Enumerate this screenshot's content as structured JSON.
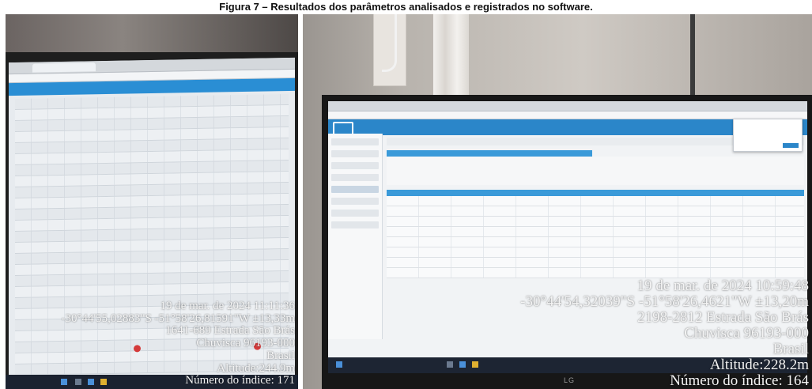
{
  "caption": "Figura 7 – Resultados dos parâmetros analisados e registrados no software.",
  "photo_left": {
    "overlay": {
      "date": "19 de mar. de 2024 11:11:36",
      "coords": "-30°44'55,02883\"S -51°58'26,81591\"W ±13,33m",
      "address": "1641-689 Estrada São Brás",
      "city": "Chuvisca 96193-000",
      "country": "Brasil",
      "altitude": "Altitude:244.9m",
      "index": "Número do índice: 171"
    }
  },
  "photo_right": {
    "brand": "LG",
    "overlay": {
      "date": "19 de mar. de 2024 10:59:48",
      "coords": "-30°44'54,32039\"S -51°58'26,4621\"W ±13,20m",
      "address": "2198-2812 Estrada São Brás",
      "city": "Chuvisca 96193-000",
      "country": "Brasil",
      "altitude": "Altitude:228.2m",
      "index": "Número do índice: 164"
    }
  },
  "colors": {
    "app_banner": "#2a8ed4",
    "marker_red": "#d43a3a"
  }
}
